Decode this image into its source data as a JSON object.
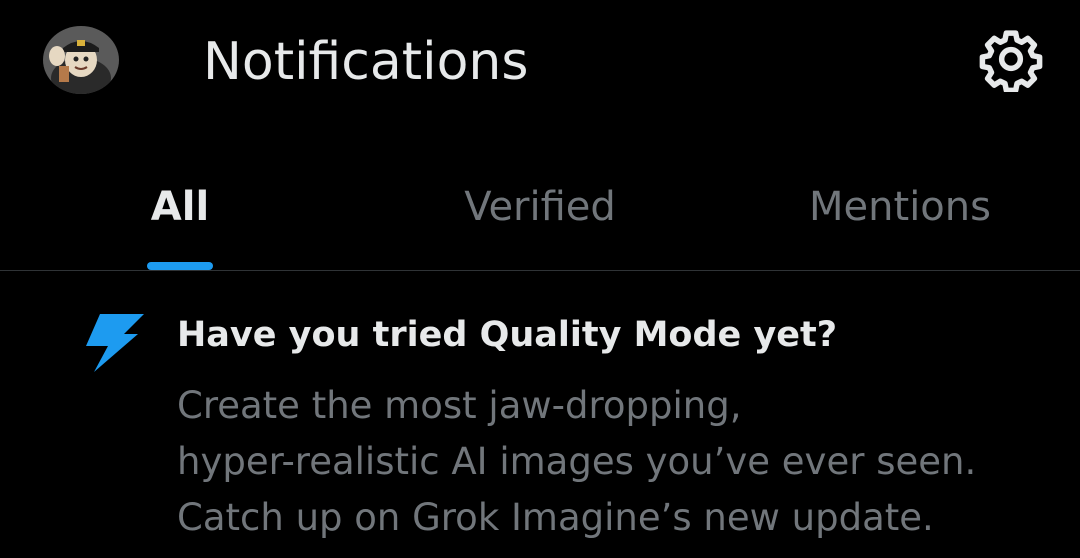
{
  "header": {
    "title": "Notifications",
    "avatar_icon": "avatar",
    "settings_icon": "gear-icon"
  },
  "tabs": [
    {
      "label": "All",
      "active": true
    },
    {
      "label": "Verified",
      "active": false
    },
    {
      "label": "Mentions",
      "active": false
    }
  ],
  "notification": {
    "icon": "lightning-bolt-icon",
    "title": "Have you tried Quality Mode yet?",
    "body_lines": [
      "Create the most jaw-dropping,",
      "hyper-realistic AI images you’ve ever seen.",
      "Catch up on Grok Imagine’s new update."
    ]
  },
  "colors": {
    "background": "#000000",
    "text_primary": "#e7e9ea",
    "text_secondary": "#71767b",
    "accent": "#1d9bf0",
    "divider": "#2f3336"
  }
}
